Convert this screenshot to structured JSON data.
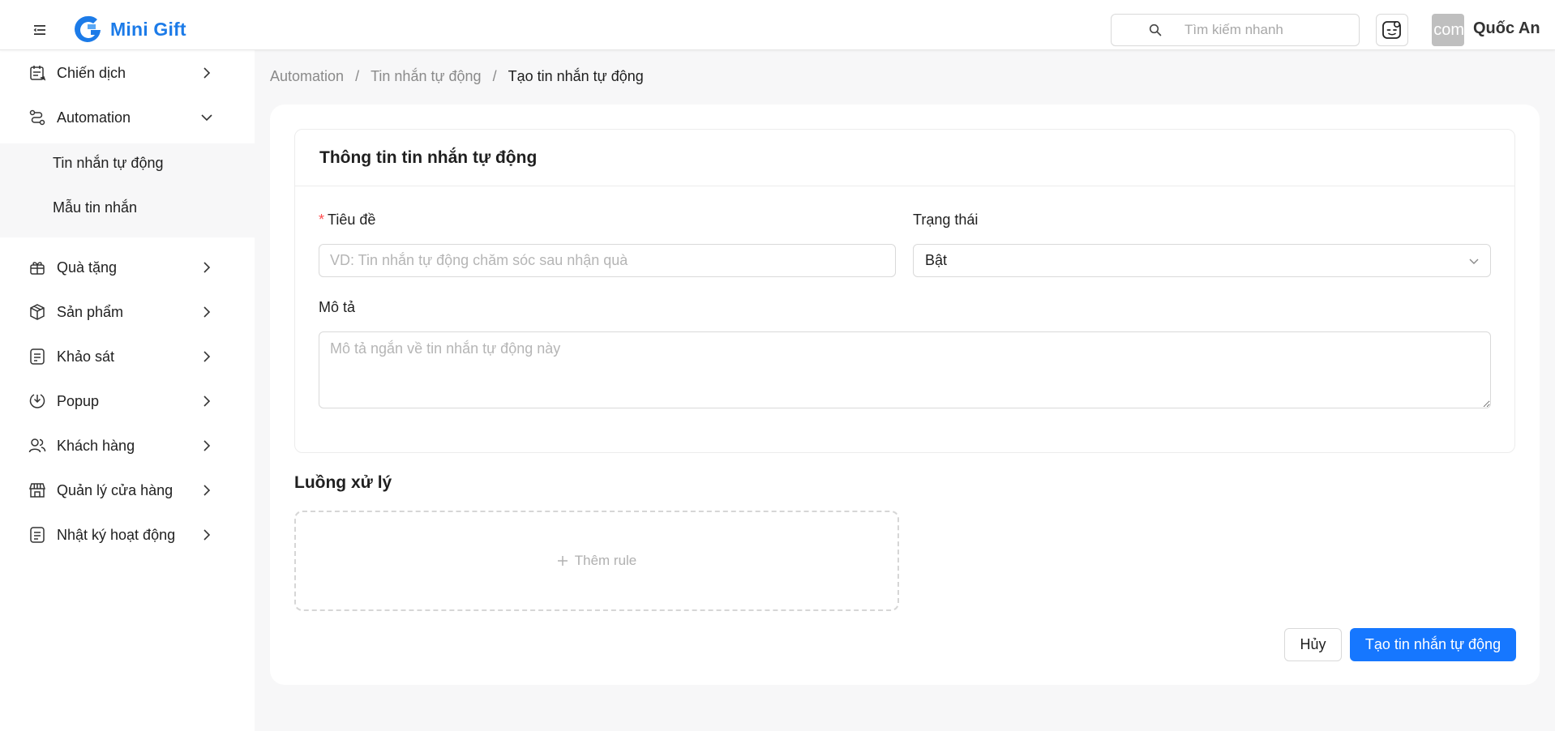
{
  "app": {
    "name": "Mini Gift"
  },
  "header": {
    "search_placeholder": "Tìm kiếm nhanh",
    "avatar_text": "com",
    "user_name": "Quốc An"
  },
  "sidebar": {
    "items": [
      {
        "label": "Chiến dịch",
        "icon": "campaign-icon"
      },
      {
        "label": "Automation",
        "icon": "automation-icon",
        "expanded": true
      },
      {
        "label": "Quà tặng",
        "icon": "gift-icon"
      },
      {
        "label": "Sản phẩm",
        "icon": "product-box-icon"
      },
      {
        "label": "Khảo sát",
        "icon": "survey-icon"
      },
      {
        "label": "Popup",
        "icon": "popup-icon"
      },
      {
        "label": "Khách hàng",
        "icon": "customers-icon"
      },
      {
        "label": "Quản lý cửa hàng",
        "icon": "store-icon"
      },
      {
        "label": "Nhật ký hoạt động",
        "icon": "activity-log-icon"
      }
    ],
    "submenu": [
      {
        "label": "Tin nhắn tự động"
      },
      {
        "label": "Mẫu tin nhắn"
      }
    ]
  },
  "breadcrumb": [
    "Automation",
    "Tin nhắn tự động",
    "Tạo tin nhắn tự động"
  ],
  "form": {
    "section_title": "Thông tin tin nhắn tự động",
    "title_label": "Tiêu đề",
    "title_placeholder": "VD: Tin nhắn tự động chăm sóc sau nhận quà",
    "title_value": "",
    "status_label": "Trạng thái",
    "status_value": "Bật",
    "description_label": "Mô tả",
    "description_placeholder": "Mô tả ngắn về tin nhắn tự động này",
    "description_value": ""
  },
  "flow": {
    "title": "Luồng xử lý",
    "add_rule_label": "Thêm rule"
  },
  "actions": {
    "cancel_label": "Hủy",
    "create_label": "Tạo tin nhắn tự động"
  },
  "colors": {
    "brand": "#1c7be8",
    "primary_button": "#1677ff",
    "required": "#ff4d4f"
  }
}
